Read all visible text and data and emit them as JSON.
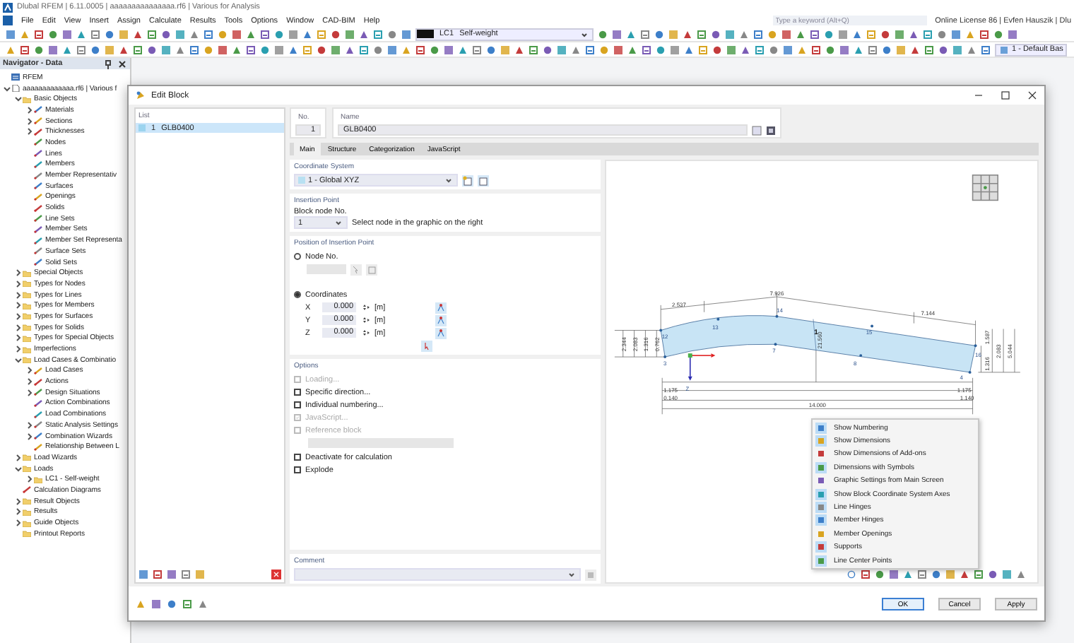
{
  "window": {
    "title": "Dlubal RFEM | 6.11.0005 | aaaaaaaaaaaaaaa.rf6 | Various for Analysis"
  },
  "menu": [
    "File",
    "Edit",
    "View",
    "Insert",
    "Assign",
    "Calculate",
    "Results",
    "Tools",
    "Options",
    "Window",
    "CAD-BIM",
    "Help"
  ],
  "search": {
    "placeholder": "Type a keyword (Alt+Q)"
  },
  "license": "Online License 86 | Evfen Hauszik | Dlu",
  "toolbar": {
    "load_case": {
      "number": "LC1",
      "name": "Self-weight"
    },
    "view": "1 - Default Bas"
  },
  "navigator": {
    "title": "Navigator - Data",
    "tree": [
      {
        "label": "RFEM",
        "kind": "root"
      },
      {
        "label": "aaaaaaaaaaaaa.rf6 | Various f",
        "kind": "file",
        "expanded": true,
        "children": [
          {
            "label": "Basic Objects",
            "kind": "folder",
            "expanded": true,
            "children": [
              {
                "label": "Materials",
                "kind": "item",
                "expanded": false
              },
              {
                "label": "Sections",
                "kind": "item",
                "expanded": false
              },
              {
                "label": "Thicknesses",
                "kind": "item",
                "expanded": false
              },
              {
                "label": "Nodes",
                "kind": "item"
              },
              {
                "label": "Lines",
                "kind": "item"
              },
              {
                "label": "Members",
                "kind": "item"
              },
              {
                "label": "Member Representativ",
                "kind": "item"
              },
              {
                "label": "Surfaces",
                "kind": "item"
              },
              {
                "label": "Openings",
                "kind": "item"
              },
              {
                "label": "Solids",
                "kind": "item"
              },
              {
                "label": "Line Sets",
                "kind": "item"
              },
              {
                "label": "Member Sets",
                "kind": "item"
              },
              {
                "label": "Member Set Representa",
                "kind": "item"
              },
              {
                "label": "Surface Sets",
                "kind": "item"
              },
              {
                "label": "Solid Sets",
                "kind": "item"
              }
            ]
          },
          {
            "label": "Special Objects",
            "kind": "folder",
            "expanded": false
          },
          {
            "label": "Types for Nodes",
            "kind": "folder",
            "expanded": false
          },
          {
            "label": "Types for Lines",
            "kind": "folder",
            "expanded": false
          },
          {
            "label": "Types for Members",
            "kind": "folder",
            "expanded": false
          },
          {
            "label": "Types for Surfaces",
            "kind": "folder",
            "expanded": false
          },
          {
            "label": "Types for Solids",
            "kind": "folder",
            "expanded": false
          },
          {
            "label": "Types for Special Objects",
            "kind": "folder",
            "expanded": false
          },
          {
            "label": "Imperfections",
            "kind": "folder",
            "expanded": false
          },
          {
            "label": "Load Cases & Combinatio",
            "kind": "folder",
            "expanded": true,
            "children": [
              {
                "label": "Load Cases",
                "kind": "item",
                "expanded": false
              },
              {
                "label": "Actions",
                "kind": "item",
                "expanded": false
              },
              {
                "label": "Design Situations",
                "kind": "item",
                "expanded": false
              },
              {
                "label": "Action Combinations",
                "kind": "item"
              },
              {
                "label": "Load Combinations",
                "kind": "item"
              },
              {
                "label": "Static Analysis Settings",
                "kind": "item",
                "expanded": false
              },
              {
                "label": "Combination Wizards",
                "kind": "item",
                "expanded": false
              },
              {
                "label": "Relationship Between L",
                "kind": "item"
              }
            ]
          },
          {
            "label": "Load Wizards",
            "kind": "folder",
            "expanded": false
          },
          {
            "label": "Loads",
            "kind": "folder",
            "expanded": true,
            "children": [
              {
                "label": "LC1 - Self-weight",
                "kind": "folder",
                "expanded": false
              }
            ]
          },
          {
            "label": "Calculation Diagrams",
            "kind": "item"
          },
          {
            "label": "Result Objects",
            "kind": "folder",
            "expanded": false
          },
          {
            "label": "Results",
            "kind": "folder",
            "expanded": false
          },
          {
            "label": "Guide Objects",
            "kind": "folder",
            "expanded": false
          },
          {
            "label": "Printout Reports",
            "kind": "folder"
          }
        ]
      }
    ]
  },
  "dialog": {
    "title": "Edit Block",
    "list": {
      "title": "List",
      "items": [
        {
          "number": "1",
          "name": "GLB0400",
          "selected": true
        }
      ]
    },
    "number": {
      "label": "No.",
      "value": "1"
    },
    "name": {
      "label": "Name",
      "value": "GLB0400"
    },
    "tabs": [
      {
        "label": "Main",
        "selected": true
      },
      {
        "label": "Structure",
        "selected": false
      },
      {
        "label": "Categorization",
        "selected": false
      },
      {
        "label": "JavaScript",
        "selected": false
      }
    ],
    "coordinate_system": {
      "title": "Coordinate System",
      "value": "1 - Global XYZ"
    },
    "insertion_point": {
      "title": "Insertion Point",
      "label": "Block node No.",
      "value": "1",
      "hint": "Select node in the graphic on the right"
    },
    "position": {
      "title": "Position of Insertion Point",
      "options": [
        {
          "label": "Node No.",
          "selected": false
        },
        {
          "label": "Coordinates",
          "selected": true
        }
      ],
      "coordinates": [
        {
          "axis": "X",
          "value": "0.000",
          "unit": "[m]"
        },
        {
          "axis": "Y",
          "value": "0.000",
          "unit": "[m]"
        },
        {
          "axis": "Z",
          "value": "0.000",
          "unit": "[m]"
        }
      ]
    },
    "options": {
      "title": "Options",
      "items": [
        {
          "kind": "checkbox",
          "label": "Loading...",
          "checked": false,
          "disabled": true
        },
        {
          "kind": "checkbox",
          "label": "Specific direction...",
          "checked": false,
          "disabled": false
        },
        {
          "kind": "checkbox",
          "label": "Individual numbering...",
          "checked": false,
          "disabled": false
        },
        {
          "kind": "checkbox",
          "label": "JavaScript...",
          "checked": true,
          "disabled": true
        },
        {
          "kind": "checkbox",
          "label": "Reference block",
          "checked": false,
          "disabled": true
        },
        {
          "kind": "field",
          "disabled": true
        },
        {
          "kind": "checkbox",
          "label": "Deactivate for calculation",
          "checked": false,
          "disabled": false
        },
        {
          "kind": "checkbox",
          "label": "Explode",
          "checked": false,
          "disabled": false
        }
      ]
    },
    "comment": {
      "title": "Comment"
    },
    "graphic": {
      "labels": [
        {
          "kind": "dimension",
          "text": "2.537"
        },
        {
          "kind": "dimension",
          "text": "7.926"
        },
        {
          "kind": "dimension",
          "text": "7.144"
        },
        {
          "kind": "dimension",
          "text": "2.344"
        },
        {
          "kind": "dimension",
          "text": "2.083"
        },
        {
          "kind": "dimension",
          "text": "1.316"
        },
        {
          "kind": "dimension",
          "text": "0.762"
        },
        {
          "kind": "dimension",
          "text": "1.587"
        },
        {
          "kind": "dimension",
          "text": "2.083"
        },
        {
          "kind": "dimension",
          "text": "5.044"
        },
        {
          "kind": "dimension",
          "text": "1.316"
        },
        {
          "kind": "dimension",
          "text": "21.560"
        },
        {
          "kind": "dimension",
          "text": "1.175"
        },
        {
          "kind": "dimension",
          "text": "1.175"
        },
        {
          "kind": "dimension",
          "text": "0.140"
        },
        {
          "kind": "dimension",
          "text": "1.140"
        },
        {
          "kind": "dimension",
          "text": "14.000"
        },
        {
          "kind": "node",
          "text": "12"
        },
        {
          "kind": "node",
          "text": "13"
        },
        {
          "kind": "node",
          "text": "14"
        },
        {
          "kind": "block",
          "text": "1"
        },
        {
          "kind": "node",
          "text": "7"
        },
        {
          "kind": "node",
          "text": "8"
        },
        {
          "kind": "node",
          "text": "15"
        },
        {
          "kind": "node",
          "text": "16"
        },
        {
          "kind": "node",
          "text": "3"
        },
        {
          "kind": "node",
          "text": "4"
        },
        {
          "kind": "axis",
          "text": "Z"
        }
      ],
      "menu": [
        {
          "label": "Show Numbering",
          "checked": true
        },
        {
          "label": "Show Dimensions",
          "checked": true
        },
        {
          "label": "Show Dimensions of Add-ons",
          "checked": false
        },
        {
          "label": "Dimensions with Symbols",
          "checked": true
        },
        {
          "label": "Graphic Settings from Main Screen",
          "checked": false
        },
        {
          "label": "Show Block Coordinate System Axes",
          "checked": true
        },
        {
          "label": "Line Hinges",
          "checked": true
        },
        {
          "label": "Member Hinges",
          "checked": true
        },
        {
          "label": "Member Openings",
          "checked": false
        },
        {
          "label": "Supports",
          "checked": true
        },
        {
          "label": "Line Center Points",
          "checked": true
        }
      ]
    },
    "buttons": [
      {
        "label": "OK",
        "default": true
      },
      {
        "label": "Cancel",
        "default": false
      },
      {
        "label": "Apply",
        "default": false
      }
    ]
  }
}
